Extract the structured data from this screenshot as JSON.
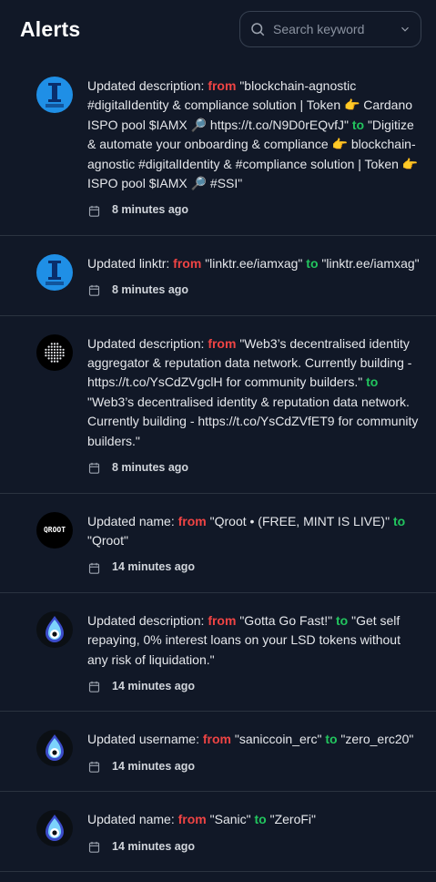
{
  "header": {
    "title": "Alerts",
    "search_placeholder": "Search keyword"
  },
  "alerts": [
    {
      "avatar": "iamx-logo",
      "prefix": "Updated description: ",
      "from_label": "from",
      "old": "\"blockchain-agnostic #digitalIdentity & compliance solution | Token 👉 Cardano ISPO pool $IAMX 🔎 https://t.co/N9D0rEQvfJ\"",
      "to_label": "to",
      "new": "\"Digitize & automate your onboarding & compliance 👉 blockchain-agnostic #digitalIdentity & #compliance solution | Token 👉 ISPO pool $IAMX 🔎 #SSI\"",
      "time": "8 minutes ago"
    },
    {
      "avatar": "iamx-logo",
      "prefix": "Updated linktr: ",
      "from_label": "from",
      "old": "\"linktr.ee/iamxag\"",
      "to_label": "to",
      "new": "\"linktr.ee/iamxag\"",
      "time": "8 minutes ago"
    },
    {
      "avatar": "web3-logo",
      "prefix": "Updated description: ",
      "from_label": "from",
      "old": "\"Web3’s decentralised identity aggregator & reputation data network. Currently building - https://t.co/YsCdZVgclH for community builders.\"",
      "to_label": "to",
      "new": "\"Web3’s decentralised identity & reputation data network. Currently building - https://t.co/YsCdZVfET9 for community builders.\"",
      "time": "8 minutes ago"
    },
    {
      "avatar": "qroot-logo",
      "avatar_text": "QROOT",
      "prefix": "Updated name: ",
      "from_label": "from",
      "old": "\"Qroot • (FREE, MINT IS LIVE)\"",
      "to_label": "to",
      "new": "\"Qroot\"",
      "time": "14 minutes ago"
    },
    {
      "avatar": "zerofi-logo",
      "prefix": "Updated description: ",
      "from_label": "from",
      "old": "\"Gotta Go Fast!\"",
      "to_label": "to",
      "new": "\"Get self repaying, 0% interest loans on your LSD tokens without any risk of liquidation.\"",
      "time": "14 minutes ago"
    },
    {
      "avatar": "zerofi-logo",
      "prefix": "Updated username: ",
      "from_label": "from",
      "old": "\"saniccoin_erc\"",
      "to_label": "to",
      "new": "\"zero_erc20\"",
      "time": "14 minutes ago"
    },
    {
      "avatar": "zerofi-logo",
      "prefix": "Updated name: ",
      "from_label": "from",
      "old": "\"Sanic\"",
      "to_label": "to",
      "new": "\"ZeroFi\"",
      "time": "14 minutes ago"
    }
  ]
}
